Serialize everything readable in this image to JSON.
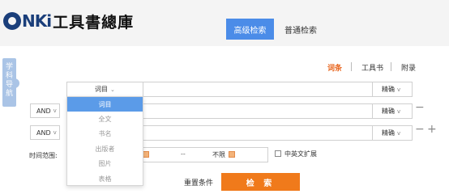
{
  "header": {
    "logo_brand": "CNKi",
    "logo_name": "工具書總庫",
    "tabs": [
      {
        "label": "高级检索",
        "active": true
      },
      {
        "label": "普通检索",
        "active": false
      }
    ]
  },
  "side_nav": {
    "label": "学科导航"
  },
  "type_tabs": [
    {
      "label": "词条",
      "active": true
    },
    {
      "label": "工具书",
      "active": false
    },
    {
      "label": "附录",
      "active": false
    }
  ],
  "rows": [
    {
      "field": "词目",
      "match": "精确",
      "logic": null
    },
    {
      "field": "",
      "match": "精确",
      "logic": "AND",
      "op": "−"
    },
    {
      "field": "",
      "match": "精确",
      "logic": "AND",
      "op_minus": "−",
      "op_plus": "+"
    }
  ],
  "field_dropdown": {
    "options": [
      "词目",
      "全文",
      "书名",
      "出版者",
      "图片",
      "表格"
    ],
    "selected": "词目"
  },
  "time_range": {
    "label": "时间范围:",
    "separator": "--",
    "end_value": "不限"
  },
  "cn_en_expand": {
    "label": "中英文扩展",
    "checked": false
  },
  "actions": {
    "reset": "重置条件",
    "search": "检 索"
  },
  "colors": {
    "accent_blue": "#4b8ce8",
    "accent_orange": "#f07a1b",
    "active_tab_text": "#e8641c"
  }
}
